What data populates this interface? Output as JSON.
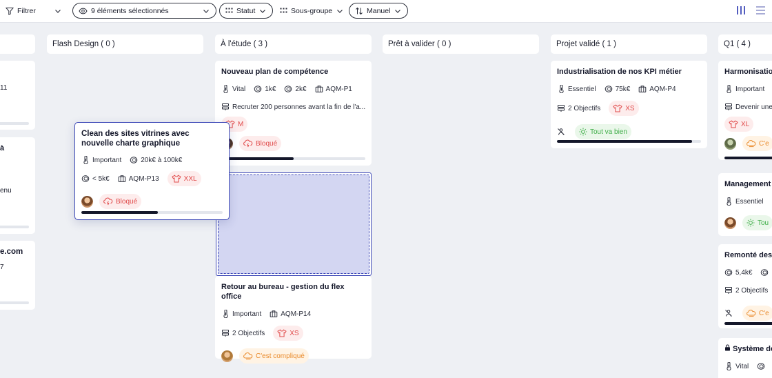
{
  "toolbar": {
    "filter_label": "Filtrer",
    "visible_label": "9 éléments sélectionnés",
    "statut_label": "Statut",
    "subgroup_label": "Sous-groupe",
    "sort_label": "Manuel"
  },
  "columns": [
    {
      "title": "Flash Design ( 0 )"
    },
    {
      "title": "À l'étude ( 3 )"
    },
    {
      "title": "Prêt à valider ( 0 )"
    },
    {
      "title": "Projet validé ( 1 )"
    },
    {
      "title": "Q1 ( 4 )"
    }
  ],
  "left_partial": {
    "c1_text": "11",
    "c2_title": "à",
    "c2_text": "enu",
    "c3_title": "e.com",
    "c3_text": "7"
  },
  "cards": {
    "plan": {
      "title": "Nouveau plan de compétence",
      "priority": "Vital",
      "cost1": "1k€",
      "cost2": "2k€",
      "code": "AQM-P1",
      "objective": "Recruter 200 personnes avant la fin de l'a...",
      "size": "M",
      "status": "Bloqué",
      "progress": 0.5
    },
    "dragged": {
      "title": "Clean des sites vitrines avec nouvelle charte graphique",
      "priority": "Important",
      "budget": "20k€ à 100k€",
      "cost": "< 5k€",
      "code": "AQM-P13",
      "size": "XXL",
      "status": "Bloqué",
      "progress": 0.54
    },
    "retour": {
      "title": "Retour au bureau - gestion du flex office",
      "priority": "Important",
      "code": "AQM-P14",
      "objectives": "2 Objectifs",
      "size": "XS",
      "status": "C'est compliqué"
    },
    "kpi": {
      "title": "Industrialisation de nos KPI métier",
      "priority": "Essentiel",
      "cost": "75k€",
      "code": "AQM-P4",
      "objectives": "2 Objectifs",
      "size": "XS",
      "status": "Tout va bien",
      "progress": 0.94
    },
    "harm": {
      "title": "Harmonisation",
      "priority": "Important",
      "objective": "Devenir une",
      "size": "XL",
      "status": "C'e"
    },
    "mgmt": {
      "title": "Management d",
      "priority": "Essentiel",
      "status": "Tou"
    },
    "remonte": {
      "title": "Remonté des p",
      "cost": "5,4k€",
      "objectives": "2 Objectifs",
      "status": "C'e"
    },
    "systeme": {
      "title": "Système de",
      "priority": "Vital"
    }
  },
  "colors": {
    "accent": "#3f4ab8",
    "danger": "#e04a4a",
    "warning": "#e98a2b",
    "success": "#3fae48"
  }
}
